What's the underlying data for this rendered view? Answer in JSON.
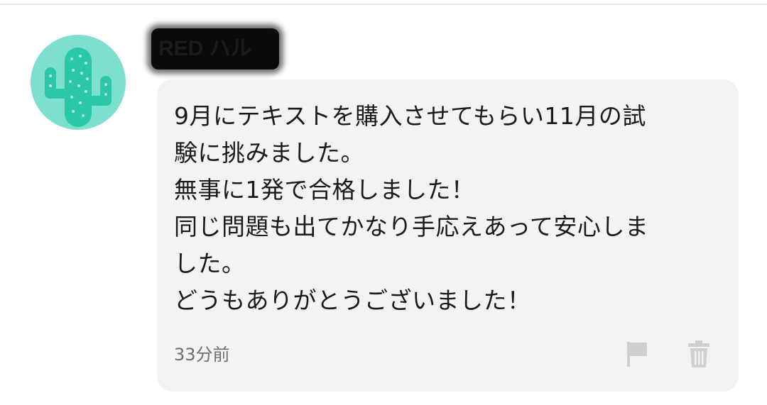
{
  "comment": {
    "username": "RED ハル",
    "message_lines": [
      "9月にテキストを購入させてもらい11月の試",
      "験に挑みました。",
      "無事に1発で合格しました！",
      "同じ問題も出てかなり手応えあって安心しま",
      "した。",
      "どうもありがとうございました！"
    ],
    "timestamp": "33分前",
    "avatar_icon": "cactus-icon",
    "actions": [
      {
        "icon": "flag-icon"
      },
      {
        "icon": "trash-icon"
      }
    ]
  },
  "colors": {
    "avatar_background": "#7cdfcf",
    "avatar_cactus": "#2bc7a9",
    "bubble_background": "#f3f3f3",
    "message_text": "#1a1a1a",
    "timestamp_text": "#6e6e6e",
    "action_icon": "#cfcfcf"
  }
}
